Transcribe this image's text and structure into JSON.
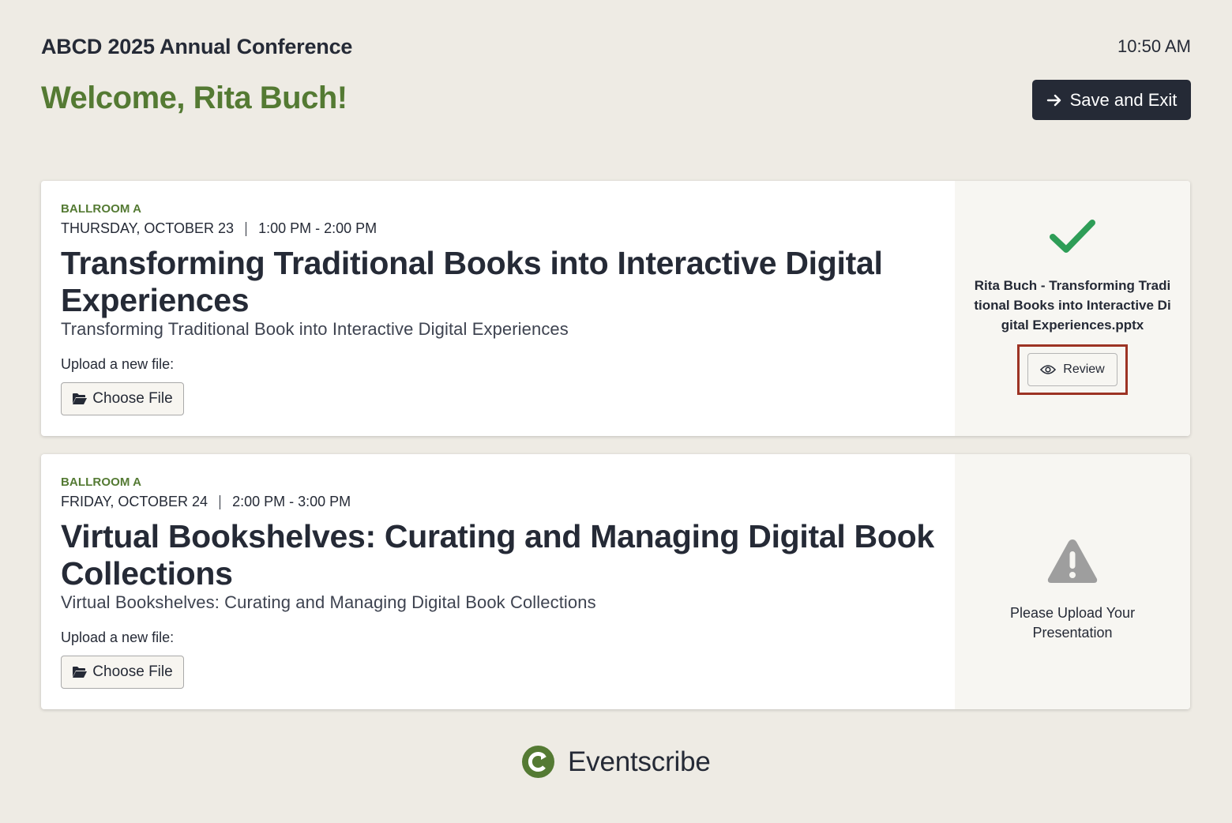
{
  "header": {
    "conference_title": "ABCD 2025 Annual Conference",
    "time": "10:50 AM",
    "welcome": "Welcome, Rita Buch!",
    "save_exit_label": "Save and Exit"
  },
  "sessions": [
    {
      "room": "BALLROOM A",
      "date": "THURSDAY, OCTOBER 23",
      "time": "1:00 PM - 2:00 PM",
      "title": "Transforming Traditional Books into Interactive Digital Experiences",
      "subtitle": "Transforming Traditional Book into Interactive Digital Experiences",
      "upload_label": "Upload a new file:",
      "choose_file_label": "Choose File",
      "status": {
        "icon": "check-icon",
        "file_name": "Rita Buch - Transforming Traditional Books into Interactive Digital Experiences.pptx",
        "review_label": "Review"
      }
    },
    {
      "room": "BALLROOM A",
      "date": "FRIDAY, OCTOBER 24",
      "time": "2:00 PM - 3:00 PM",
      "title": "Virtual Bookshelves: Curating and Managing Digital Book Collections",
      "subtitle": "Virtual Bookshelves: Curating and Managing Digital Book Collections",
      "upload_label": "Upload a new file:",
      "choose_file_label": "Choose File",
      "status": {
        "icon": "warning-icon",
        "message": "Please Upload Your Presentation"
      }
    }
  ],
  "footer": {
    "brand_name": "Eventscribe"
  },
  "colors": {
    "accent_green": "#547a33",
    "check_green": "#2e9d57",
    "dark": "#252a36",
    "background": "#eeebe4",
    "highlight_red": "#9c3324",
    "warning_gray": "#9e9e9e"
  }
}
